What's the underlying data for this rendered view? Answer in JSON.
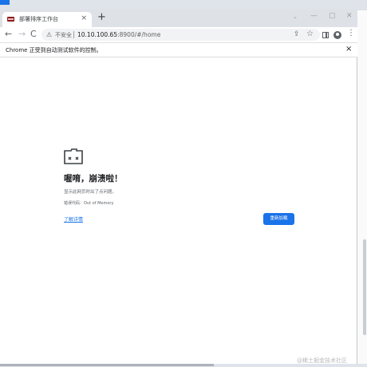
{
  "tab": {
    "title": "部署排序工作台",
    "close": "×"
  },
  "new_tab": "+",
  "window_controls": {
    "dropdown": "⌄",
    "minimize": "—",
    "maximize": "▢",
    "close": "✕"
  },
  "toolbar": {
    "back": "←",
    "forward": "→",
    "reload": "C",
    "insecure_label": "不安全",
    "url_host": "10.10.100.65",
    "url_rest": ":8900/#/home",
    "share": "⇪",
    "star": "☆",
    "menu": "⋮"
  },
  "infobar": {
    "text": "Chrome 正受到自动测试软件的控制。",
    "close": "×"
  },
  "error": {
    "title": "喔唷，崩溃啦！",
    "description": "显示此网页时出了点问题。",
    "code": "错误代码：Out of Memory",
    "details_link": "了解详情",
    "reload_button": "重新加载"
  },
  "watermark": "@稀土掘金技术社区",
  "colors": {
    "accent": "#1a73e8",
    "titlebar": "#dee1e6"
  }
}
